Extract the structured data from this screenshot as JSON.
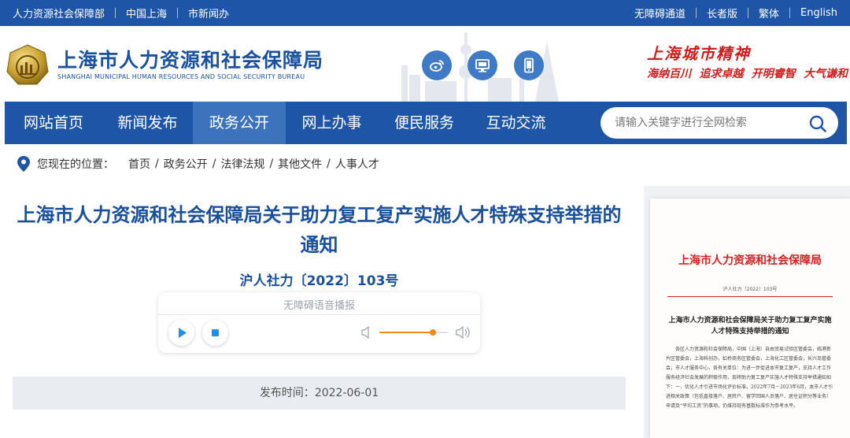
{
  "topbar": {
    "left_links": [
      "人力资源社会保障部",
      "中国上海",
      "市新闻办"
    ],
    "right_links": [
      "无障碍通道",
      "长者版",
      "繁体",
      "English"
    ]
  },
  "header": {
    "org_name_cn": "上海市人力资源和社会保障局",
    "org_name_en": "SHANGHAI MUNICIPAL HUMAN RESOURCES AND SOCIAL SECURITY BUREAU",
    "icon_buttons": [
      "weibo-icon",
      "desktop-icon",
      "mobile-icon"
    ],
    "spirit_title": "上海城市精神",
    "spirit_words": [
      "海纳百川",
      "追求卓越",
      "开明睿智",
      "大气谦和"
    ]
  },
  "nav": {
    "items": [
      "网站首页",
      "新闻发布",
      "政务公开",
      "网上办事",
      "便民服务",
      "互动交流"
    ],
    "active_index": 2,
    "search_placeholder": "请输入关键字进行全网检索"
  },
  "breadcrumb": {
    "label": "您现在的位置：",
    "items": [
      "首页",
      "政务公开",
      "法律法规",
      "其他文件",
      "人事人才"
    ]
  },
  "article": {
    "title": "上海市人力资源和社会保障局关于助力复工复产实施人才特殊支持举措的通知",
    "doc_number": "沪人社力〔2022〕103号",
    "player_label": "无障碍语音播报",
    "volume_level": 0.78,
    "publish_label": "发布时间：",
    "publish_date": "2022-06-01"
  },
  "preview": {
    "header": "上海市人力资源和社会保障局",
    "doc_number": "沪人社力〔2022〕103号",
    "title": "上海市人力资源和社会保障局关于助力复工复产实施人才特殊支持举措的通知",
    "body": "各区人力资源和社会保障局，中国（上海）自由贸易试验区管委会，临港新片区管委会，上海科创办，虹桥商务区管委会，上海化工区管委会，长兴岛管委会，市人才服务中心，各有关单位：为进一步促进本市复工复产，支持人才工作服务经济社会发展的积极作用，现将助力复工复产实施人才特殊支持举措通知如下：一、优化人才引进市场化评价标准。2022年7月－2023年6月，本市人才引进相关政策（包括直接落户、居转户、留学回国人员落户、居住证积分等业务）申请及“平均工资”的事项，仍维持现有基数标准作为参考水平。"
  },
  "colors": {
    "brand_blue": "#1f55a7",
    "nav_active": "#3d73bd",
    "title_blue": "#1a4f9c",
    "spirit_red": "#d31c1c",
    "volume_orange": "#f08a1c"
  }
}
